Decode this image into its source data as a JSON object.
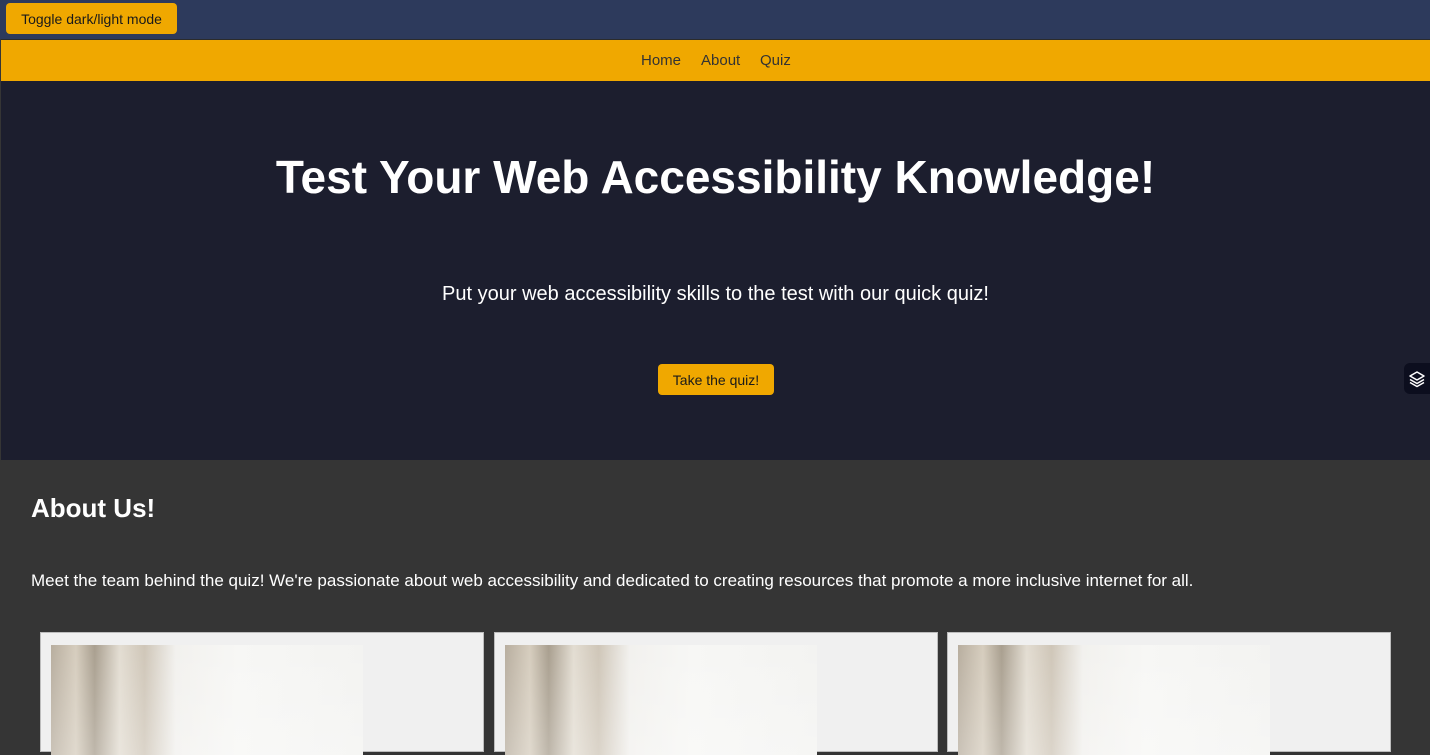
{
  "topbar": {
    "toggle_label": "Toggle dark/light mode"
  },
  "nav": {
    "items": [
      "Home",
      "About",
      "Quiz"
    ]
  },
  "hero": {
    "title": "Test Your Web Accessibility Knowledge!",
    "subtitle": "Put your web accessibility skills to the test with our quick quiz!",
    "cta_label": "Take the quiz!"
  },
  "side_widget": {
    "icon": "layers-icon"
  },
  "about": {
    "title": "About Us!",
    "text": "Meet the team behind the quiz! We're passionate about web accessibility and dedicated to creating resources that promote a more inclusive internet for all."
  },
  "team_cards": [
    {
      "image": "curtain-photo"
    },
    {
      "image": "curtain-photo"
    },
    {
      "image": "curtain-photo"
    }
  ],
  "colors": {
    "accent": "#f0a800",
    "topbar": "#2d3a5c",
    "hero_bg": "#1c1e2e",
    "about_bg": "#353535"
  }
}
